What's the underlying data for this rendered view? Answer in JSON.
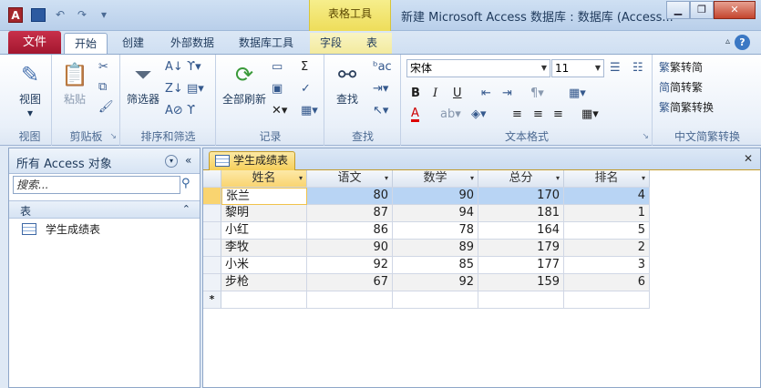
{
  "window": {
    "title": "新建 Microsoft Access 数据库 : 数据库 (Access...",
    "context_group": "表格工具",
    "app_icon_letter": "A",
    "minimize": "▁",
    "restore": "❐",
    "close": "✕"
  },
  "qat": {
    "save": "",
    "undo": "↶",
    "redo": "↷",
    "customize": "▾"
  },
  "tabs": {
    "file": "文件",
    "home": "开始",
    "create": "创建",
    "external": "外部数据",
    "dbtools": "数据库工具",
    "fields": "字段",
    "table": "表",
    "help": "?",
    "minimize_ribbon": "▵"
  },
  "ribbon": {
    "views": {
      "label": "视图",
      "view_btn": "视图",
      "dd": "▾"
    },
    "clipboard": {
      "label": "剪贴板",
      "paste_btn": "粘贴"
    },
    "sort_filter": {
      "label": "排序和筛选",
      "filter_btn": "筛选器"
    },
    "records": {
      "label": "记录",
      "refresh_btn": "全部刷新"
    },
    "find": {
      "label": "查找",
      "find_btn": "查找"
    },
    "text_format": {
      "label": "文本格式",
      "font_name": "宋体",
      "font_size": "11",
      "bold": "B",
      "italic": "I",
      "underline": "U",
      "font_color": "A"
    },
    "chinese": {
      "label": "中文简繁转换",
      "trad_to_simp": "繁转简",
      "simp_to_trad": "简转繁",
      "convert": "简繁转换"
    },
    "launcher": "↘"
  },
  "nav": {
    "title": "所有 Access 对象",
    "dd": "▾",
    "collapse": "«",
    "search_placeholder": "搜索...",
    "search_icon": "⚲",
    "section": "表",
    "section_icon": "⌃",
    "items": [
      {
        "label": "学生成绩表"
      }
    ]
  },
  "doc": {
    "tab_label": "学生成绩表",
    "close": "✕",
    "new_row_marker": "*",
    "sort_arrow": "▾",
    "columns": [
      "姓名",
      "语文",
      "数学",
      "总分",
      "排名"
    ],
    "rows": [
      [
        "张兰",
        "80",
        "90",
        "170",
        "4"
      ],
      [
        "黎明",
        "87",
        "94",
        "181",
        "1"
      ],
      [
        "小红",
        "86",
        "78",
        "164",
        "5"
      ],
      [
        "李牧",
        "90",
        "89",
        "179",
        "2"
      ],
      [
        "小米",
        "92",
        "85",
        "177",
        "3"
      ],
      [
        "步枪",
        "67",
        "92",
        "159",
        "6"
      ]
    ],
    "current_row_index": 0
  }
}
